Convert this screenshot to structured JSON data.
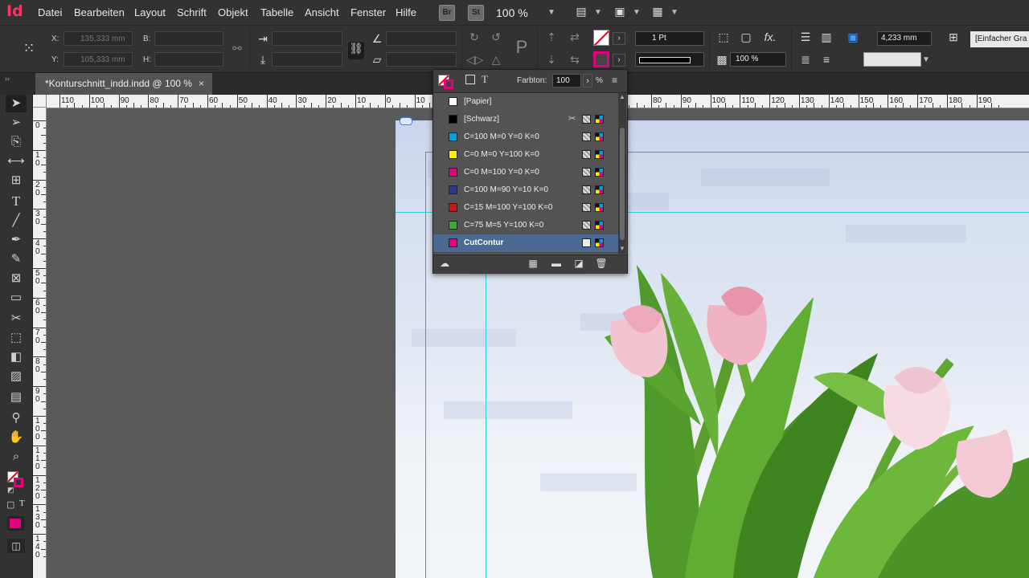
{
  "app": {
    "logo": "Id"
  },
  "menu": [
    "Datei",
    "Bearbeiten",
    "Layout",
    "Schrift",
    "Objekt",
    "Tabelle",
    "Ansicht",
    "Fenster",
    "Hilfe"
  ],
  "bridge_badges": {
    "br": "Br",
    "st": "St"
  },
  "zoom": "100 %",
  "control": {
    "x_label": "X:",
    "x_value": "135,333 mm",
    "y_label": "Y:",
    "y_value": "105,333 mm",
    "b_label": "B:",
    "b_value": "",
    "h_label": "H:",
    "h_value": "",
    "stroke_weight": "1 Pt",
    "opacity": "100 %",
    "offset": "4,233 mm",
    "object_style": "[Einfacher Gra"
  },
  "tab": {
    "title": "*Konturschnitt_indd.indd @ 100 %",
    "close": "×"
  },
  "ruler": {
    "h_labels": [
      "110",
      "100",
      "90",
      "80",
      "70",
      "60",
      "50",
      "40",
      "30",
      "20",
      "10",
      "0",
      "10",
      "",
      "",
      "",
      "",
      "",
      "",
      "",
      "80",
      "90",
      "100",
      "110",
      "120",
      "130",
      "140",
      "150",
      "160",
      "170",
      "180",
      "190"
    ],
    "v_labels": [
      "0",
      "10",
      "20",
      "30",
      "40",
      "50",
      "60",
      "70",
      "80",
      "90",
      "100",
      "110",
      "120",
      "130",
      "140"
    ]
  },
  "swatches": {
    "tint_label": "Farbton:",
    "tint_value": "100",
    "percent": "%",
    "items": [
      {
        "name": "[Papier]",
        "color": "#ffffff",
        "selected": false,
        "bold": false
      },
      {
        "name": "[Schwarz]",
        "color": "#000000",
        "selected": false,
        "bold": false
      },
      {
        "name": "C=100 M=0 Y=0 K=0",
        "color": "#00a0e3",
        "selected": false,
        "bold": false
      },
      {
        "name": "C=0 M=0 Y=100 K=0",
        "color": "#ffed00",
        "selected": false,
        "bold": false
      },
      {
        "name": "C=0 M=100 Y=0 K=0",
        "color": "#e5007e",
        "selected": false,
        "bold": false
      },
      {
        "name": "C=100 M=90 Y=10 K=0",
        "color": "#2b3a8a",
        "selected": false,
        "bold": false
      },
      {
        "name": "C=15 M=100 Y=100 K=0",
        "color": "#c8161d",
        "selected": false,
        "bold": false
      },
      {
        "name": "C=75 M=5 Y=100 K=0",
        "color": "#3aa935",
        "selected": false,
        "bold": false
      },
      {
        "name": "CutContur",
        "color": "#e5007e",
        "selected": true,
        "bold": true
      }
    ]
  },
  "colors": {
    "accent": "#e5007e",
    "selection": "#4a6a93",
    "guide_magenta": "#d44fd4",
    "guide_cyan": "#2ad0e0"
  }
}
